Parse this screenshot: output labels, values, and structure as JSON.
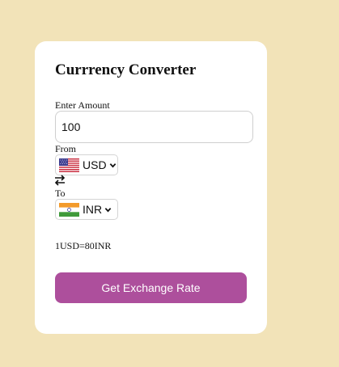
{
  "converter": {
    "title": "Currrency Converter",
    "amount_label": "Enter Amount",
    "amount_value": "100",
    "from_label": "From",
    "from_currency": "USD",
    "from_flag": "us-flag-icon",
    "to_label": "To",
    "to_currency": "INR",
    "to_flag": "india-flag-icon",
    "result_text": "1USD=80INR",
    "button_label": "Get Exchange Rate"
  },
  "colors": {
    "page_background": "#f2e3b8",
    "card_background": "#ffffff",
    "button_background": "#ad4f9c",
    "button_text": "#ffffff"
  }
}
